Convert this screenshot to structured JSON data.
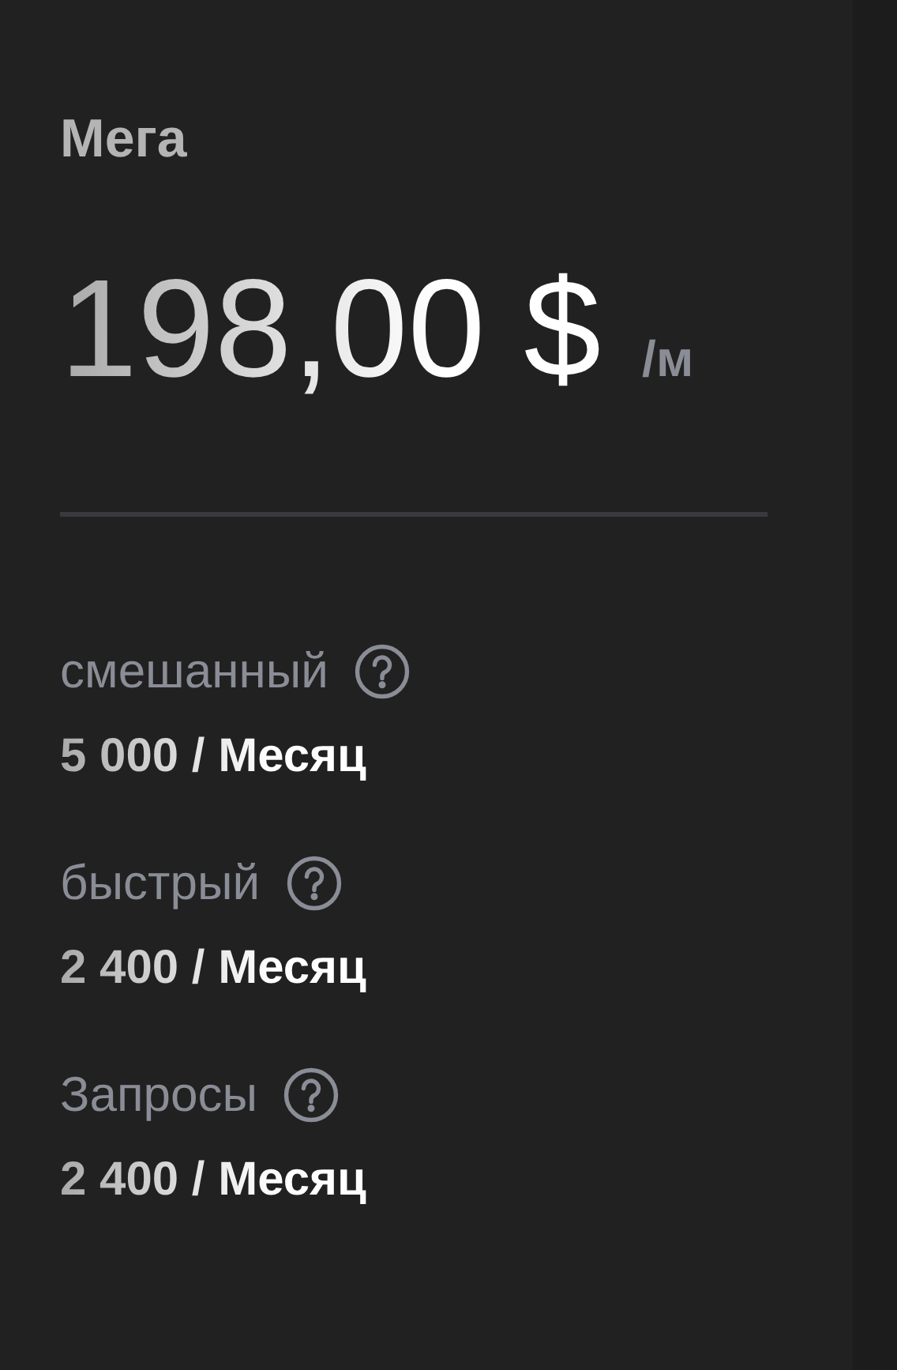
{
  "plan": {
    "name": "Мега",
    "price": "198,00 $",
    "period": "/м"
  },
  "features": [
    {
      "label": "смешанный",
      "value": "5 000 / Месяц"
    },
    {
      "label": "быстрый",
      "value": "2 400 / Месяц"
    },
    {
      "label": "Запросы",
      "value": "2 400 / Месяц"
    }
  ]
}
